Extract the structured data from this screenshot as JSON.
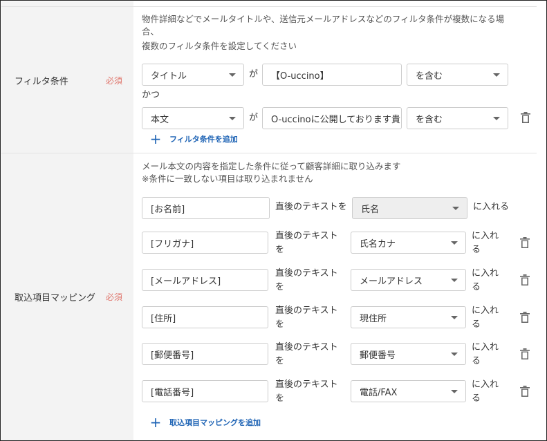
{
  "filter_section": {
    "label": "フィルタ条件",
    "required": "必須",
    "desc_line1": "物件詳細などでメールタイトルや、送信元メールアドレスなどのフィルタ条件が複数になる場",
    "desc_line2": "合、",
    "desc_line3": "複数のフィルタ条件を設定してください",
    "rows": [
      {
        "field": "タイトル",
        "connector": "が",
        "value": "【O-uccino】",
        "operator": "を含む"
      },
      {
        "field": "本文",
        "connector": "が",
        "value": "O-uccinoに公開しております貴",
        "operator": "を含む"
      }
    ],
    "joiner": "かつ",
    "add_label": "フィルタ条件を追加"
  },
  "mapping_section": {
    "label": "取込項目マッピング",
    "required": "必須",
    "desc_line1": "メール本文の内容を指定した条件に従って顧客詳細に取り込みます",
    "desc_line2": "※条件に一致しない項目は取り込まれません",
    "first_row": {
      "source": "[お名前]",
      "middle": "直後のテキストを",
      "target": "氏名",
      "suffix": "に入れる"
    },
    "rows": [
      {
        "source": "[フリガナ]",
        "middle_1": "直後のテキスト",
        "middle_2": "を",
        "target": "氏名カナ",
        "suffix_1": "に入れ",
        "suffix_2": "る"
      },
      {
        "source": "[メールアドレス]",
        "middle_1": "直後のテキスト",
        "middle_2": "を",
        "target": "メールアドレス",
        "suffix_1": "に入れ",
        "suffix_2": "る"
      },
      {
        "source": "[住所]",
        "middle_1": "直後のテキスト",
        "middle_2": "を",
        "target": "現住所",
        "suffix_1": "に入れ",
        "suffix_2": "る"
      },
      {
        "source": "[郵便番号]",
        "middle_1": "直後のテキスト",
        "middle_2": "を",
        "target": "郵便番号",
        "suffix_1": "に入れ",
        "suffix_2": "る"
      },
      {
        "source": "[電話番号]",
        "middle_1": "直後のテキスト",
        "middle_2": "を",
        "target": "電話/FAX",
        "suffix_1": "に入れ",
        "suffix_2": "る"
      }
    ],
    "add_label": "取込項目マッピングを追加"
  },
  "colors": {
    "accent": "#1f64b5",
    "required": "#e0766d",
    "left_bg": "#f3f3f3",
    "disabled_bg": "#eeeeee"
  },
  "icons": {
    "trash": "trash-icon",
    "add": "plus-icon",
    "dropdown": "chevron-down-icon"
  }
}
